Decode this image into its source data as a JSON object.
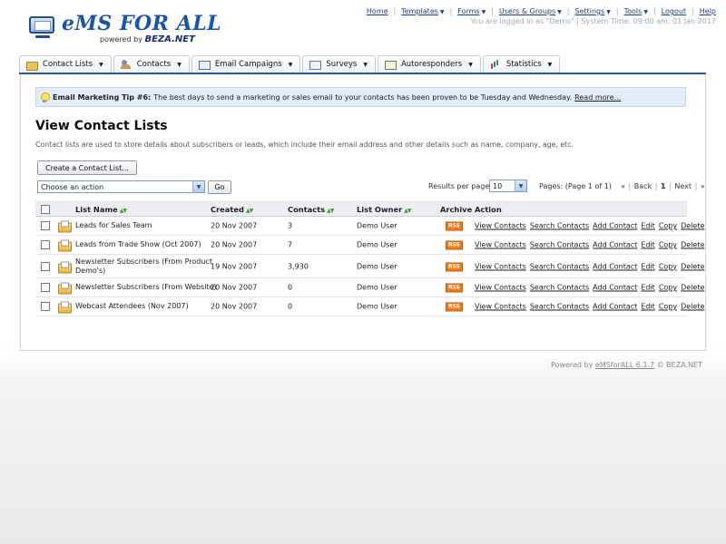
{
  "header": {
    "brand": "eMS FOR ALL",
    "powered_by": "powered by",
    "powered_brand": "BEZA.NET",
    "nav": [
      {
        "label": "Home",
        "has_dropdown": false
      },
      {
        "label": "Templates",
        "has_dropdown": true
      },
      {
        "label": "Forms",
        "has_dropdown": true
      },
      {
        "label": "Users & Groups",
        "has_dropdown": true
      },
      {
        "label": "Settings",
        "has_dropdown": true
      },
      {
        "label": "Tools",
        "has_dropdown": true
      },
      {
        "label": "Logout",
        "has_dropdown": false
      },
      {
        "label": "Help",
        "has_dropdown": false
      }
    ],
    "status": "You are logged in as \"Demo\" | System Time: 09:00 am, 01 Jan 2017"
  },
  "tabs": [
    {
      "label": "Contact Lists",
      "icon": "contact-lists-icon"
    },
    {
      "label": "Contacts",
      "icon": "contacts-icon"
    },
    {
      "label": "Email Campaigns",
      "icon": "email-campaigns-icon"
    },
    {
      "label": "Surveys",
      "icon": "surveys-icon"
    },
    {
      "label": "Autoresponders",
      "icon": "autoresponders-icon"
    },
    {
      "label": "Statistics",
      "icon": "statistics-icon"
    }
  ],
  "tip": {
    "title": "Email Marketing Tip #6:",
    "text": "The best days to send a marketing or sales email to your contacts has been proven to be Tuesday and Wednesday.",
    "link": "Read more..."
  },
  "page": {
    "title": "View Contact Lists",
    "intro": "Contact lists are used to store details about subscribers or leads, which include their email address and other details such as name, company, age, etc.",
    "create_button": "Create a Contact List...",
    "action_select": "Choose an action",
    "go_button": "Go",
    "results_per_page_label": "Results per page:",
    "results_per_page": "10",
    "paging_info": "Pages: (Page 1 of 1)",
    "paging": {
      "first": "«",
      "back": "Back",
      "current": "1",
      "next": "Next",
      "last": "»"
    }
  },
  "table": {
    "headers": {
      "list_name": "List Name",
      "created": "Created",
      "contacts": "Contacts",
      "list_owner": "List Owner",
      "archive": "Archive",
      "action": "Action"
    },
    "archive_badge": "RSS",
    "actions": [
      "View Contacts",
      "Search Contacts",
      "Add Contact",
      "Edit",
      "Copy",
      "Delete"
    ],
    "rows": [
      {
        "name": "Leads for Sales Team",
        "name2": "",
        "created": "20 Nov 2007",
        "contacts": "3",
        "owner": "Demo User"
      },
      {
        "name": "Leads from Trade Show (Oct 2007)",
        "name2": "",
        "created": "20 Nov 2007",
        "contacts": "7",
        "owner": "Demo User"
      },
      {
        "name": "Newsletter Subscribers (From Product",
        "name2": "Demo's)",
        "created": "19 Nov 2007",
        "contacts": "3,930",
        "owner": "Demo User"
      },
      {
        "name": "Newsletter Subscribers (From Website)",
        "name2": "",
        "created": "20 Nov 2007",
        "contacts": "0",
        "owner": "Demo User"
      },
      {
        "name": "Webcast Attendees (Nov 2007)",
        "name2": "",
        "created": "20 Nov 2007",
        "contacts": "0",
        "owner": "Demo User"
      }
    ]
  },
  "footer": {
    "prefix": "Powered by",
    "link": "eMSforALL 6.1.7",
    "suffix": "© BEZA.NET"
  }
}
